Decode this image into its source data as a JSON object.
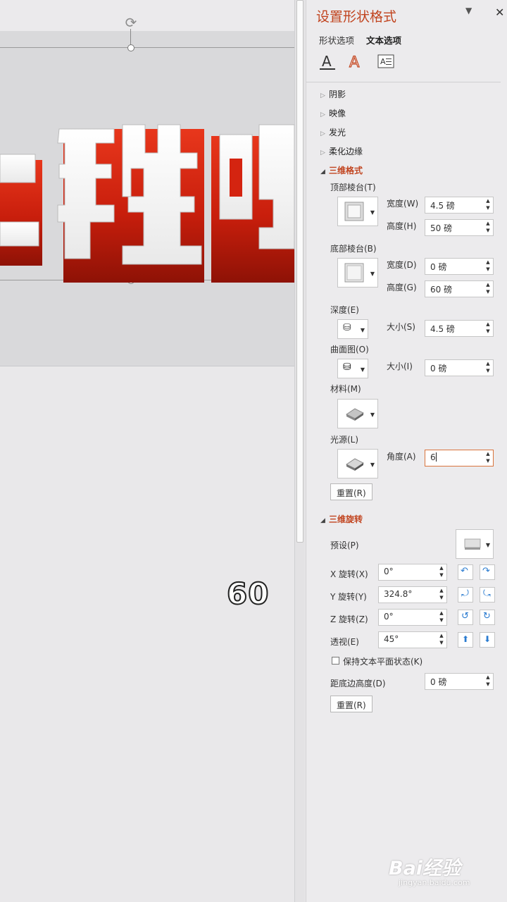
{
  "canvas": {
    "headline_text": "二班哈",
    "overlay_number": "60",
    "colors": {
      "letter_red": "#d42410",
      "slide_bg": "#d9d9db"
    }
  },
  "pane": {
    "title": "设置形状格式",
    "tabs": {
      "shape": "形状选项",
      "text": "文本选项"
    },
    "icon_tabs": [
      "text-fill-outline-icon",
      "text-effects-icon",
      "textbox-layout-icon"
    ],
    "sections": {
      "shadow": "阴影",
      "reflection": "映像",
      "glow": "发光",
      "soft_edges": "柔化边缘",
      "format_3d": "三维格式",
      "rotation_3d": "三维旋转"
    },
    "format_3d": {
      "top_bevel_label": "顶部棱台(T)",
      "top_width_label": "宽度(W)",
      "top_width_value": "4.5 磅",
      "top_height_label": "高度(H)",
      "top_height_value": "50 磅",
      "bottom_bevel_label": "底部棱台(B)",
      "bottom_width_label": "宽度(D)",
      "bottom_width_value": "0 磅",
      "bottom_height_label": "高度(G)",
      "bottom_height_value": "60 磅",
      "depth_label": "深度(E)",
      "depth_size_label": "大小(S)",
      "depth_size_value": "4.5 磅",
      "contour_label": "曲面图(O)",
      "contour_size_label": "大小(I)",
      "contour_size_value": "0 磅",
      "material_label": "材料(M)",
      "lighting_label": "光源(L)",
      "angle_label": "角度(A)",
      "angle_value": "6",
      "reset_label": "重置(R)"
    },
    "rotation_3d": {
      "preset_label": "预设(P)",
      "x_label": "X 旋转(X)",
      "x_value": "0°",
      "y_label": "Y 旋转(Y)",
      "y_value": "324.8°",
      "z_label": "Z 旋转(Z)",
      "z_value": "0°",
      "perspective_label": "透视(E)",
      "perspective_value": "45°",
      "keep_flat_label": "保持文本平面状态(K)",
      "distance_label": "距底边高度(D)",
      "distance_value": "0 磅",
      "reset_label": "重置(R)"
    },
    "colors": {
      "accent": "#c1441f",
      "focus_border": "#d9743d",
      "rotate_blue": "#2a7bd0"
    }
  },
  "watermark": {
    "brand": "Bai经验",
    "url": "jingyan.baidu.com"
  }
}
